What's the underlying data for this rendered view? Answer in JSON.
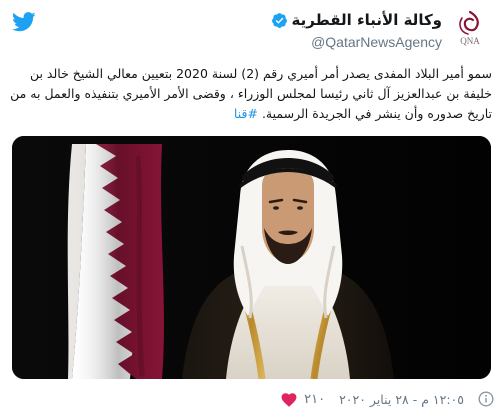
{
  "tweet": {
    "display_name": "وكالة الأنباء القطرية",
    "handle": "@QatarNewsAgency",
    "avatar_label": "QNA",
    "text_main": "سمو أمير البلاد المفدى يصدر أمر أميري رقم (2) لسنة 2020 بتعيين معالي الشيخ خالد بن خليفة بن عبدالعزيز آل ثاني رئيسا لمجلس الوزراء ، وقضى الأمر الأميري بتنفيذه والعمل به من تاريخ صدوره وأن ينشر في الجريدة الرسمية.",
    "hashtag": "#قنا",
    "timestamp": "١٢:٠٥ م - ٢٨ يناير ٢٠٢٠",
    "like_count": "٢١٠"
  },
  "colors": {
    "accent": "#1da1f2",
    "hashtag": "#1b95e0",
    "muted": "#657786",
    "like": "#e0245e",
    "flag_maroon": "#8a1538"
  },
  "icons": {
    "brand": "twitter-bird-icon",
    "verified": "verified-badge-icon",
    "info": "info-icon",
    "like": "heart-icon"
  }
}
